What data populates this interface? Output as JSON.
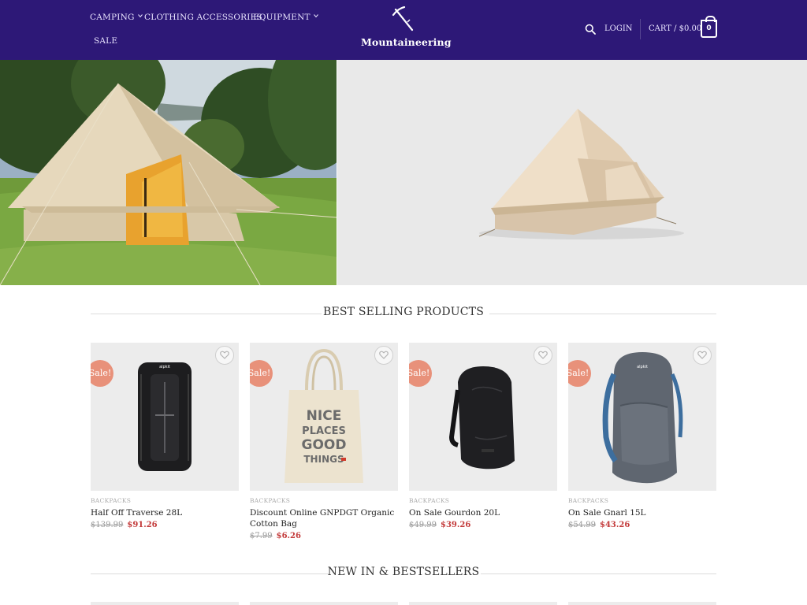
{
  "header": {
    "nav": [
      {
        "label": "Camping",
        "has_dropdown": true
      },
      {
        "label": "Clothing Accessories",
        "has_dropdown": false
      },
      {
        "label": "Equipment",
        "has_dropdown": true
      },
      {
        "label": "Sale",
        "has_dropdown": false
      }
    ],
    "logo_text": "Mountaineering",
    "login_label": "Login",
    "cart_label": "Cart / $0.00",
    "cart_count": "0",
    "background": "#2d1877"
  },
  "sections": {
    "best_selling_title": "Best Selling Products",
    "new_in_title": "New In & Bestsellers"
  },
  "products": [
    {
      "badge": "Sale!",
      "category": "Backpacks",
      "name": "Half Off Traverse 28L",
      "old_price": "$139.99",
      "price": "$91.26",
      "image": "black-backpack"
    },
    {
      "badge": "Sale!",
      "category": "Backpacks",
      "name": "Discount Online GNPDGT Organic Cotton Bag",
      "old_price": "$7.99",
      "price": "$6.26",
      "image": "tote-bag"
    },
    {
      "badge": "Sale!",
      "category": "Backpacks",
      "name": "On Sale Gourdon 20L",
      "old_price": "$49.99",
      "price": "$39.26",
      "image": "black-daypack"
    },
    {
      "badge": "Sale!",
      "category": "Backpacks",
      "name": "On Sale Gnarl 15L",
      "old_price": "$54.99",
      "price": "$43.26",
      "image": "grey-backpack"
    }
  ],
  "tote_print": [
    "NICE",
    "PLACES",
    "GOOD",
    "THINGS"
  ],
  "colors": {
    "sale_badge": "#e8917a",
    "sale_price": "#c33a3a",
    "nav_text": "#e9e4ff"
  }
}
